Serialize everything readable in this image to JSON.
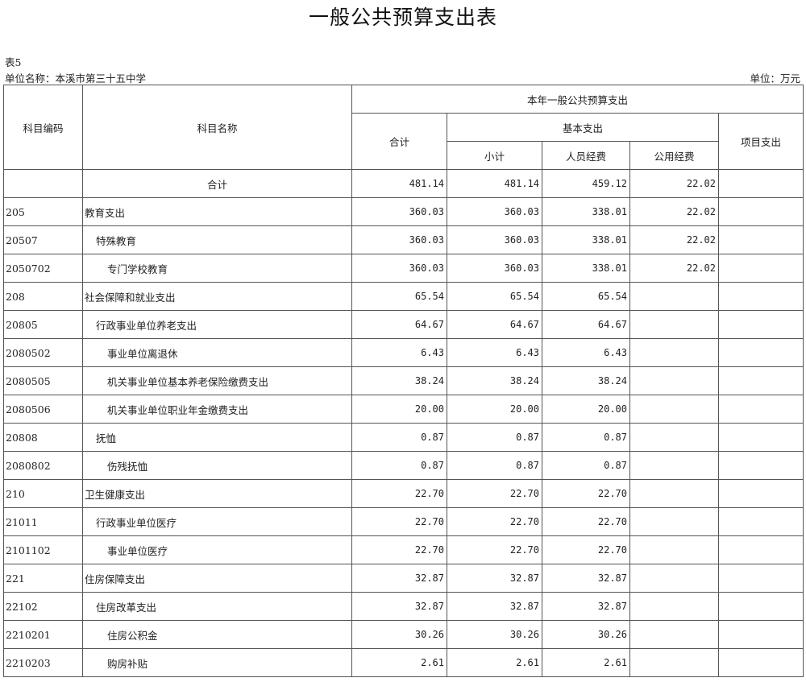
{
  "title": "一般公共预算支出表",
  "table_no": "表5",
  "unit_name": "单位名称：本溪市第三十五中学",
  "unit_label": "单位：万元",
  "headers": {
    "code": "科目编码",
    "name": "科目名称",
    "group": "本年一般公共预算支出",
    "total": "合计",
    "basic": "基本支出",
    "subtotal": "小计",
    "personnel": "人员经费",
    "public": "公用经费",
    "project": "项目支出"
  },
  "total_row": {
    "label": "合计",
    "total": "481.14",
    "subtotal": "481.14",
    "personnel": "459.12",
    "public": "22.02",
    "project": ""
  },
  "rows": [
    {
      "code": "205",
      "name": "教育支出",
      "level": 0,
      "total": "360.03",
      "subtotal": "360.03",
      "personnel": "338.01",
      "public": "22.02",
      "project": ""
    },
    {
      "code": "20507",
      "name": "特殊教育",
      "level": 1,
      "total": "360.03",
      "subtotal": "360.03",
      "personnel": "338.01",
      "public": "22.02",
      "project": ""
    },
    {
      "code": "2050702",
      "name": "专门学校教育",
      "level": 2,
      "total": "360.03",
      "subtotal": "360.03",
      "personnel": "338.01",
      "public": "22.02",
      "project": ""
    },
    {
      "code": "208",
      "name": "社会保障和就业支出",
      "level": 0,
      "total": "65.54",
      "subtotal": "65.54",
      "personnel": "65.54",
      "public": "",
      "project": ""
    },
    {
      "code": "20805",
      "name": "行政事业单位养老支出",
      "level": 1,
      "total": "64.67",
      "subtotal": "64.67",
      "personnel": "64.67",
      "public": "",
      "project": ""
    },
    {
      "code": "2080502",
      "name": "事业单位离退休",
      "level": 2,
      "total": "6.43",
      "subtotal": "6.43",
      "personnel": "6.43",
      "public": "",
      "project": ""
    },
    {
      "code": "2080505",
      "name": "机关事业单位基本养老保险缴费支出",
      "level": 2,
      "total": "38.24",
      "subtotal": "38.24",
      "personnel": "38.24",
      "public": "",
      "project": ""
    },
    {
      "code": "2080506",
      "name": "机关事业单位职业年金缴费支出",
      "level": 2,
      "total": "20.00",
      "subtotal": "20.00",
      "personnel": "20.00",
      "public": "",
      "project": ""
    },
    {
      "code": "20808",
      "name": "抚恤",
      "level": 1,
      "total": "0.87",
      "subtotal": "0.87",
      "personnel": "0.87",
      "public": "",
      "project": ""
    },
    {
      "code": "2080802",
      "name": "伤残抚恤",
      "level": 2,
      "total": "0.87",
      "subtotal": "0.87",
      "personnel": "0.87",
      "public": "",
      "project": ""
    },
    {
      "code": "210",
      "name": "卫生健康支出",
      "level": 0,
      "total": "22.70",
      "subtotal": "22.70",
      "personnel": "22.70",
      "public": "",
      "project": ""
    },
    {
      "code": "21011",
      "name": "行政事业单位医疗",
      "level": 1,
      "total": "22.70",
      "subtotal": "22.70",
      "personnel": "22.70",
      "public": "",
      "project": ""
    },
    {
      "code": "2101102",
      "name": "事业单位医疗",
      "level": 2,
      "total": "22.70",
      "subtotal": "22.70",
      "personnel": "22.70",
      "public": "",
      "project": ""
    },
    {
      "code": "221",
      "name": "住房保障支出",
      "level": 0,
      "total": "32.87",
      "subtotal": "32.87",
      "personnel": "32.87",
      "public": "",
      "project": ""
    },
    {
      "code": "22102",
      "name": "住房改革支出",
      "level": 1,
      "total": "32.87",
      "subtotal": "32.87",
      "personnel": "32.87",
      "public": "",
      "project": ""
    },
    {
      "code": "2210201",
      "name": "住房公积金",
      "level": 2,
      "total": "30.26",
      "subtotal": "30.26",
      "personnel": "30.26",
      "public": "",
      "project": ""
    },
    {
      "code": "2210203",
      "name": "购房补贴",
      "level": 2,
      "total": "2.61",
      "subtotal": "2.61",
      "personnel": "2.61",
      "public": "",
      "project": ""
    }
  ]
}
